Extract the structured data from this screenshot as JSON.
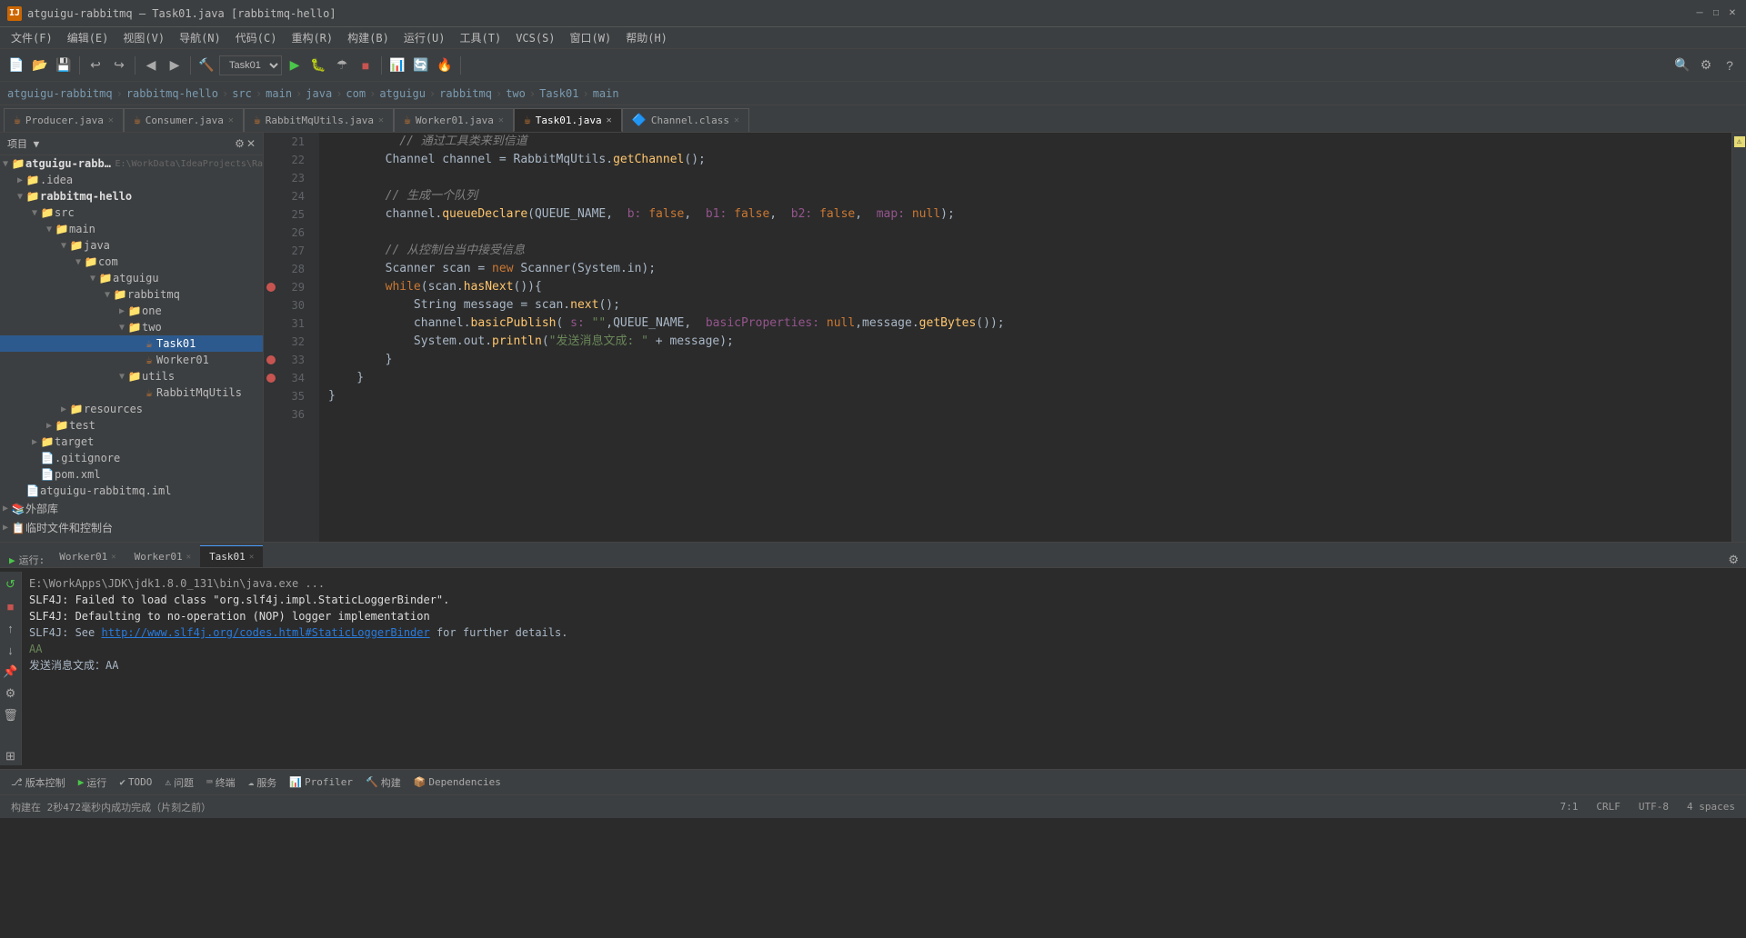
{
  "titleBar": {
    "title": "atguigu-rabbitmq – Task01.java [rabbitmq-hello]",
    "icon": "IJ",
    "controls": [
      "minimize",
      "maximize",
      "close"
    ]
  },
  "menuBar": {
    "items": [
      "文件(F)",
      "编辑(E)",
      "视图(V)",
      "导航(N)",
      "代码(C)",
      "重构(R)",
      "构建(B)",
      "运行(U)",
      "工具(T)",
      "VCS(S)",
      "窗口(W)",
      "帮助(H)"
    ]
  },
  "toolbar": {
    "runConfig": "Task01",
    "buttons": [
      "open",
      "save",
      "saveAll",
      "undo",
      "redo",
      "back",
      "forward",
      "build",
      "run",
      "debug",
      "stop",
      "coverage",
      "profile",
      "reload"
    ]
  },
  "breadcrumb": {
    "parts": [
      "atguigu-rabbitmq",
      "rabbitmq-hello",
      "src",
      "main",
      "java",
      "com",
      "atguigu",
      "rabbitmq",
      "two",
      "Task01",
      "main"
    ]
  },
  "fileTabs": [
    {
      "name": "Producer.java",
      "color": "#cc7832",
      "active": false
    },
    {
      "name": "Consumer.java",
      "color": "#cc7832",
      "active": false
    },
    {
      "name": "RabbitMqUtils.java",
      "color": "#cc7832",
      "active": false
    },
    {
      "name": "Worker01.java",
      "color": "#cc7832",
      "active": false
    },
    {
      "name": "Task01.java",
      "color": "#cc7832",
      "active": true
    },
    {
      "name": "Channel.class",
      "color": "#cc7832",
      "active": false
    }
  ],
  "sidebar": {
    "title": "项目",
    "tree": [
      {
        "indent": 0,
        "arrow": "▼",
        "icon": "📁",
        "label": "atguigu-rabbitmq",
        "extra": "E:\\WorkData\\IdeaProjects\\Ra",
        "expanded": true
      },
      {
        "indent": 1,
        "arrow": "▼",
        "icon": "📁",
        "label": ".idea",
        "expanded": false
      },
      {
        "indent": 1,
        "arrow": "▼",
        "icon": "📁",
        "label": "rabbitmq-hello",
        "expanded": true,
        "bold": true
      },
      {
        "indent": 2,
        "arrow": "▼",
        "icon": "📁",
        "label": "src",
        "expanded": true
      },
      {
        "indent": 3,
        "arrow": "▼",
        "icon": "📁",
        "label": "main",
        "expanded": true
      },
      {
        "indent": 4,
        "arrow": "▼",
        "icon": "📁",
        "label": "java",
        "expanded": true
      },
      {
        "indent": 5,
        "arrow": "▼",
        "icon": "📁",
        "label": "com",
        "expanded": true
      },
      {
        "indent": 6,
        "arrow": "▼",
        "icon": "📁",
        "label": "atguigu",
        "expanded": true
      },
      {
        "indent": 7,
        "arrow": "▼",
        "icon": "📁",
        "label": "rabbitmq",
        "expanded": true
      },
      {
        "indent": 8,
        "arrow": "▶",
        "icon": "📁",
        "label": "one",
        "expanded": false
      },
      {
        "indent": 8,
        "arrow": "▼",
        "icon": "📁",
        "label": "two",
        "expanded": true
      },
      {
        "indent": 9,
        "arrow": "",
        "icon": "☕",
        "label": "Task01",
        "selected": true
      },
      {
        "indent": 9,
        "arrow": "",
        "icon": "☕",
        "label": "Worker01",
        "selected": false
      },
      {
        "indent": 8,
        "arrow": "▶",
        "icon": "📁",
        "label": "utils",
        "expanded": false
      },
      {
        "indent": 9,
        "arrow": "",
        "icon": "☕",
        "label": "RabbitMqUtils"
      },
      {
        "indent": 3,
        "arrow": "▶",
        "icon": "📁",
        "label": "resources",
        "expanded": false
      },
      {
        "indent": 2,
        "arrow": "▶",
        "icon": "📁",
        "label": "test",
        "expanded": false
      },
      {
        "indent": 1,
        "arrow": "▶",
        "icon": "📁",
        "label": "target",
        "expanded": false
      },
      {
        "indent": 1,
        "arrow": "",
        "icon": "📄",
        "label": ".gitignore"
      },
      {
        "indent": 1,
        "arrow": "",
        "icon": "📄",
        "label": "pom.xml"
      },
      {
        "indent": 0,
        "arrow": "",
        "icon": "📄",
        "label": "atguigu-rabbitmq.iml"
      },
      {
        "indent": 0,
        "arrow": "▶",
        "icon": "📁",
        "label": "外部库",
        "expanded": false
      },
      {
        "indent": 0,
        "arrow": "▶",
        "icon": "📁",
        "label": "临时文件和控制台",
        "expanded": false
      }
    ]
  },
  "codeEditor": {
    "startLine": 21,
    "lines": [
      {
        "num": 21,
        "content": "        // 通过工具类来到信道",
        "type": "comment",
        "annotation": null
      },
      {
        "num": 22,
        "content": "        Channel channel = RabbitMqUtils.getChannel();",
        "type": "code",
        "annotation": null
      },
      {
        "num": 23,
        "content": "",
        "type": "blank",
        "annotation": null
      },
      {
        "num": 24,
        "content": "        // 生成一个队列",
        "type": "comment",
        "annotation": null
      },
      {
        "num": 25,
        "content": "        channel.queueDeclare(QUEUE_NAME,  b: false,  b1: false,  b2: false,  map: null);",
        "type": "code",
        "annotation": null
      },
      {
        "num": 26,
        "content": "",
        "type": "blank",
        "annotation": null
      },
      {
        "num": 27,
        "content": "        // 从控制台当中接受信息",
        "type": "comment",
        "annotation": null
      },
      {
        "num": 28,
        "content": "        Scanner scan = new Scanner(System.in);",
        "type": "code",
        "annotation": null
      },
      {
        "num": 29,
        "content": "        while(scan.hasNext()){",
        "type": "code",
        "annotation": "breakpoint"
      },
      {
        "num": 30,
        "content": "            String message = scan.next();",
        "type": "code",
        "annotation": null
      },
      {
        "num": 31,
        "content": "            channel.basicPublish( s: \"\",QUEUE_NAME,  basicProperties: null,message.getBytes());",
        "type": "code",
        "annotation": null
      },
      {
        "num": 32,
        "content": "            System.out.println(\"发送消息文成: \" + message);",
        "type": "code",
        "annotation": null
      },
      {
        "num": 33,
        "content": "        }",
        "type": "code",
        "annotation": "breakpoint"
      },
      {
        "num": 34,
        "content": "    }",
        "type": "code",
        "annotation": "breakpoint"
      },
      {
        "num": 35,
        "content": "}",
        "type": "code",
        "annotation": null
      },
      {
        "num": 36,
        "content": "",
        "type": "blank",
        "annotation": null
      }
    ]
  },
  "runTabs": [
    {
      "name": "Worker01",
      "active": false,
      "closeable": true
    },
    {
      "name": "Worker01",
      "active": false,
      "closeable": true
    },
    {
      "name": "Task01",
      "active": true,
      "closeable": true
    }
  ],
  "consoleOutput": [
    {
      "text": "E:\\WorkApps\\JDK\\jdk1.8.0_131\\bin\\java.exe ...",
      "type": "cmd"
    },
    {
      "text": "SLF4J: Failed to load class \"org.slf4j.impl.StaticLoggerBinder\".",
      "type": "warn"
    },
    {
      "text": "SLF4J: Defaulting to no-operation (NOP) logger implementation",
      "type": "warn"
    },
    {
      "text": "SLF4J: See http://www.slf4j.org/codes.html#StaticLoggerBinder for further details.",
      "type": "link",
      "linkText": "http://www.slf4j.org/codes.html#StaticLoggerBinder",
      "prefix": "SLF4J: See ",
      "suffix": " for further details."
    },
    {
      "text": "AA",
      "type": "green"
    },
    {
      "text": "发送消息文成：AA",
      "type": "normal"
    }
  ],
  "statusBar": {
    "left": "构建在 2秒472毫秒内成功完成（片刻之前）",
    "right": {
      "line": "7",
      "col": "1",
      "encoding": "UTF-8",
      "lineEnding": "CRLF",
      "indent": "4 spaces"
    }
  },
  "bottomToolbar": {
    "items": [
      {
        "label": "版本控制",
        "icon": "⎇",
        "active": false
      },
      {
        "label": "运行",
        "icon": "▶",
        "active": false
      },
      {
        "label": "TODO",
        "icon": "✔",
        "active": false
      },
      {
        "label": "问题",
        "icon": "⚠",
        "active": false
      },
      {
        "label": "终端",
        "icon": "⌨",
        "active": false
      },
      {
        "label": "服务",
        "icon": "☁",
        "active": false
      },
      {
        "label": "Profiler",
        "icon": "📊",
        "active": false
      },
      {
        "label": "构建",
        "icon": "🔨",
        "active": false
      },
      {
        "label": "Dependencies",
        "icon": "📦",
        "active": false
      }
    ]
  }
}
